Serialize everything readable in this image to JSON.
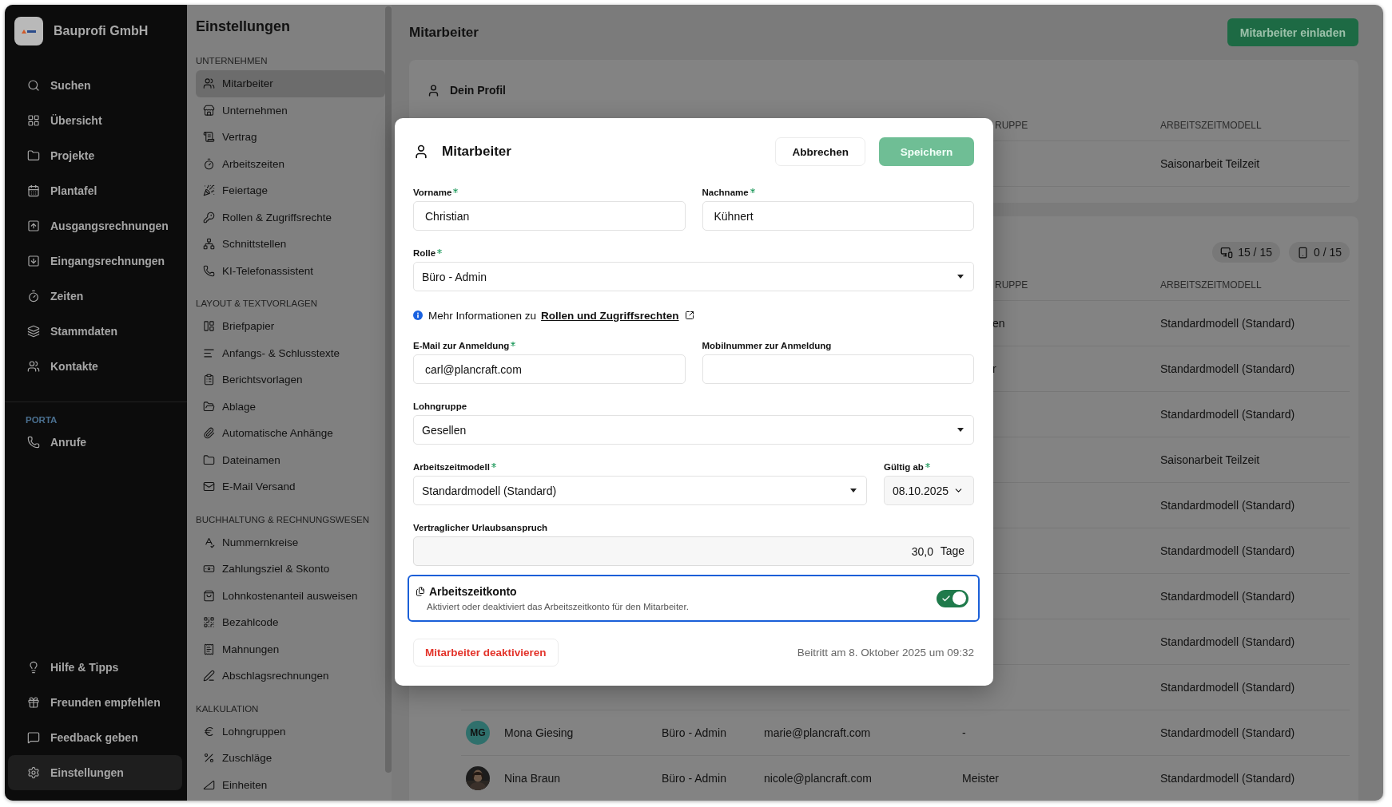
{
  "sidebar": {
    "company": "Bauprofi GmbH",
    "nav": [
      {
        "label": "Suchen",
        "selected": false
      },
      {
        "label": "Übersicht",
        "selected": false
      },
      {
        "label": "Projekte",
        "selected": false
      },
      {
        "label": "Plantafel",
        "selected": false
      },
      {
        "label": "Ausgangsrechnungen",
        "selected": false
      },
      {
        "label": "Eingangsrechnungen",
        "selected": false
      },
      {
        "label": "Zeiten",
        "selected": false
      },
      {
        "label": "Stammdaten",
        "selected": false
      },
      {
        "label": "Kontakte",
        "selected": false
      }
    ],
    "porta": {
      "title": "PORTA",
      "items": [
        {
          "label": "Anrufe",
          "selected": false
        }
      ]
    },
    "bottom": [
      {
        "label": "Hilfe & Tipps",
        "selected": false
      },
      {
        "label": "Freunden empfehlen",
        "selected": false
      },
      {
        "label": "Feedback geben",
        "selected": false
      },
      {
        "label": "Einstellungen",
        "selected": true
      }
    ]
  },
  "settings_nav": {
    "title": "Einstellungen",
    "sections": [
      {
        "title": "UNTERNEHMEN",
        "items": [
          {
            "label": "Mitarbeiter",
            "selected": true
          },
          {
            "label": "Unternehmen",
            "selected": false
          },
          {
            "label": "Vertrag",
            "selected": false
          },
          {
            "label": "Arbeitszeiten",
            "selected": false
          },
          {
            "label": "Feiertage",
            "selected": false
          },
          {
            "label": "Rollen & Zugriffsrechte",
            "selected": false
          },
          {
            "label": "Schnittstellen",
            "selected": false
          },
          {
            "label": "KI-Telefonassistent",
            "selected": false
          }
        ]
      },
      {
        "title": "LAYOUT & TEXTVORLAGEN",
        "items": [
          {
            "label": "Briefpapier",
            "selected": false
          },
          {
            "label": "Anfangs- & Schlusstexte",
            "selected": false
          },
          {
            "label": "Berichtsvorlagen",
            "selected": false
          },
          {
            "label": "Ablage",
            "selected": false
          },
          {
            "label": "Automatische Anhänge",
            "selected": false
          },
          {
            "label": "Dateinamen",
            "selected": false
          },
          {
            "label": "E-Mail Versand",
            "selected": false
          }
        ]
      },
      {
        "title": "BUCHHALTUNG & RECHNUNGSWESEN",
        "items": [
          {
            "label": "Nummernkreise",
            "selected": false
          },
          {
            "label": "Zahlungsziel & Skonto",
            "selected": false
          },
          {
            "label": "Lohnkostenanteil ausweisen",
            "selected": false
          },
          {
            "label": "Bezahlcode",
            "selected": false
          },
          {
            "label": "Mahnungen",
            "selected": false
          },
          {
            "label": "Abschlagsrechnungen",
            "selected": false
          }
        ]
      },
      {
        "title": "KALKULATION",
        "items": [
          {
            "label": "Lohngruppen",
            "selected": false
          },
          {
            "label": "Zuschläge",
            "selected": false
          },
          {
            "label": "Einheiten",
            "selected": false
          }
        ]
      }
    ]
  },
  "page": {
    "title": "Mitarbeiter",
    "invite_button": "Mitarbeiter einladen"
  },
  "profile_card": {
    "title": "Dein Profil",
    "header": {
      "column_5": "RUPPE",
      "model": "ARBEITSZEITMODELL"
    },
    "rows": [
      {
        "model": "Saisonarbeit Teilzeit"
      }
    ]
  },
  "team_card": {
    "badges": [
      {
        "label": "15 / 15"
      },
      {
        "label": "0 / 15"
      }
    ],
    "header": {
      "column_5": "RUPPE",
      "model": "ARBEITSZEITMODELL"
    },
    "rows": [
      {
        "column_5": "en",
        "model": "Standardmodell (Standard)"
      },
      {
        "column_5": "r",
        "model": "Standardmodell (Standard)"
      },
      {
        "model": "Standardmodell (Standard)"
      },
      {
        "model": "Saisonarbeit Teilzeit"
      },
      {
        "model": "Standardmodell (Standard)"
      },
      {
        "model": "Standardmodell (Standard)"
      },
      {
        "model": "Standardmodell (Standard)"
      },
      {
        "model": "Standardmodell (Standard)"
      },
      {
        "model": "Standardmodell (Standard)"
      },
      {
        "avatar": {
          "kind": "initials",
          "initials": "MG",
          "color": "#2f706c"
        },
        "name": "Mona Giesing",
        "role": "Büro - Admin",
        "email": "marie@plancraft.com",
        "group": "-",
        "model": "Standardmodell (Standard)"
      },
      {
        "name": "Nina Braun",
        "role": "Büro - Admin",
        "email": "nicole@plancraft.com",
        "group": "Meister",
        "model": "Standardmodell (Standard)"
      }
    ]
  },
  "dialog": {
    "title": "Mitarbeiter",
    "cancel_button": "Abbrechen",
    "save_button": {
      "label": "Speichern",
      "disabled": true
    },
    "first_name": {
      "label": "Vorname",
      "required": true,
      "value": "Christian"
    },
    "last_name": {
      "label": "Nachname",
      "required": true,
      "value": "Kühnert"
    },
    "role": {
      "label": "Rolle",
      "required": true,
      "value": "Büro - Admin"
    },
    "info": {
      "text": "Mehr Informationen zu",
      "link": "Rollen und Zugriffsrechten"
    },
    "email": {
      "label": "E-Mail zur Anmeldung",
      "required": true,
      "value": "carl@plancraft.com"
    },
    "mobile": {
      "label": "Mobilnummer zur Anmeldung",
      "required": false
    },
    "wage_group": {
      "label": "Lohngruppe",
      "required": false,
      "value": "Gesellen"
    },
    "work_model": {
      "label": "Arbeitszeitmodell",
      "required": true,
      "value": "Standardmodell (Standard)"
    },
    "valid_from": {
      "label": "Gültig ab",
      "required": true,
      "value": "08.10.2025"
    },
    "vacation": {
      "label": "Vertraglicher Urlaubsanspruch",
      "required": false,
      "value": "30,0",
      "unit": "Tage"
    },
    "time_account": {
      "title": "Arbeitszeitkonto",
      "description": "Aktiviert oder deaktiviert das Arbeitszeitkonto für den Mitarbeiter.",
      "on": true
    },
    "deactivate_button": "Mitarbeiter deaktivieren",
    "joined": "Beitritt am 8. Oktober 2025 um 09:32"
  }
}
